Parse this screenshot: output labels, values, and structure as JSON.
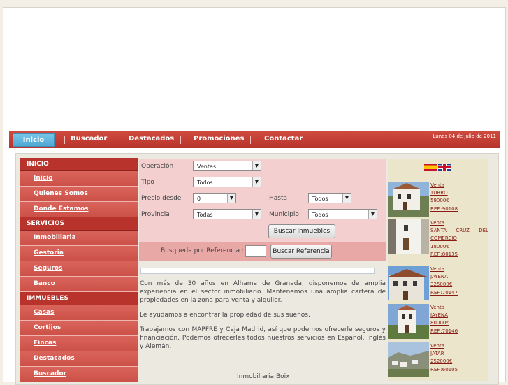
{
  "nav": {
    "items": [
      "Inicio",
      "Buscador",
      "Destacados",
      "Promociones",
      "Contactar"
    ],
    "date": "Lunes 04 de julio de 2011"
  },
  "sidebar": {
    "sections": [
      {
        "title": "INICIO",
        "items": [
          "Inicio",
          "Quienes Somos",
          "Donde Estamos"
        ]
      },
      {
        "title": "SERVICIOS",
        "items": [
          "Inmobiliaria",
          "Gestoria",
          "Seguros",
          "Banco"
        ]
      },
      {
        "title": "IMMUEBLES",
        "items": [
          "Casas",
          "Cortijos",
          "Fincas",
          "Destacados",
          "Buscador"
        ]
      }
    ]
  },
  "search": {
    "operacion_label": "Operación",
    "operacion_value": "Ventas",
    "tipo_label": "Tipo",
    "tipo_value": "Todos",
    "precio_label": "Precio desde",
    "precio_value": "0",
    "hasta_label": "Hasta",
    "hasta_value": "Todos",
    "provincia_label": "Provincia",
    "provincia_value": "Todas",
    "municipio_label": "Municipio",
    "municipio_value": "Todos",
    "buscar_inmuebles": "Buscar Inmuebles",
    "referencia_label": "Busqueda por Referencia :",
    "buscar_referencia": "Buscar Referencia"
  },
  "content": {
    "p1": "Con más de 30 años en Alhama de Granada, disponemos de amplia experiencia en el sector inmobiliario. Mantenemos una amplia cartera de propiedades en la zona para venta y alquiler.",
    "p2": "Le ayudamos a encontrar la propiedad de sus sueños.",
    "p3": "Trabajamos con MAPFRE y Caja Madrid, así que podemos ofrecerle seguros y financiación. Podemos ofrecerles todos nuestros servicios en Español, Inglés y Alemán.",
    "footer": "Inmobiliaria Boix"
  },
  "listings": [
    {
      "type": "Venta",
      "place": "TURRO",
      "price": "59000€",
      "ref": "REF.:90108"
    },
    {
      "type": "Venta",
      "place": "SANTA CRUZ DEL COMERCIO",
      "price": "18000€",
      "ref": "REF.:80135"
    },
    {
      "type": "Venta",
      "place": "JAYENA",
      "price": "325000€",
      "ref": "REF.:70147"
    },
    {
      "type": "Venta",
      "place": "JAYENA",
      "price": "80000€",
      "ref": "REF.:70146"
    },
    {
      "type": "Venta",
      "place": "JATAR",
      "price": "252000€",
      "ref": "REF.:60105"
    }
  ],
  "colors": {
    "accent": "#b7332b",
    "nav_active": "#4fa7d3",
    "search_bg": "#f3d0cf"
  }
}
